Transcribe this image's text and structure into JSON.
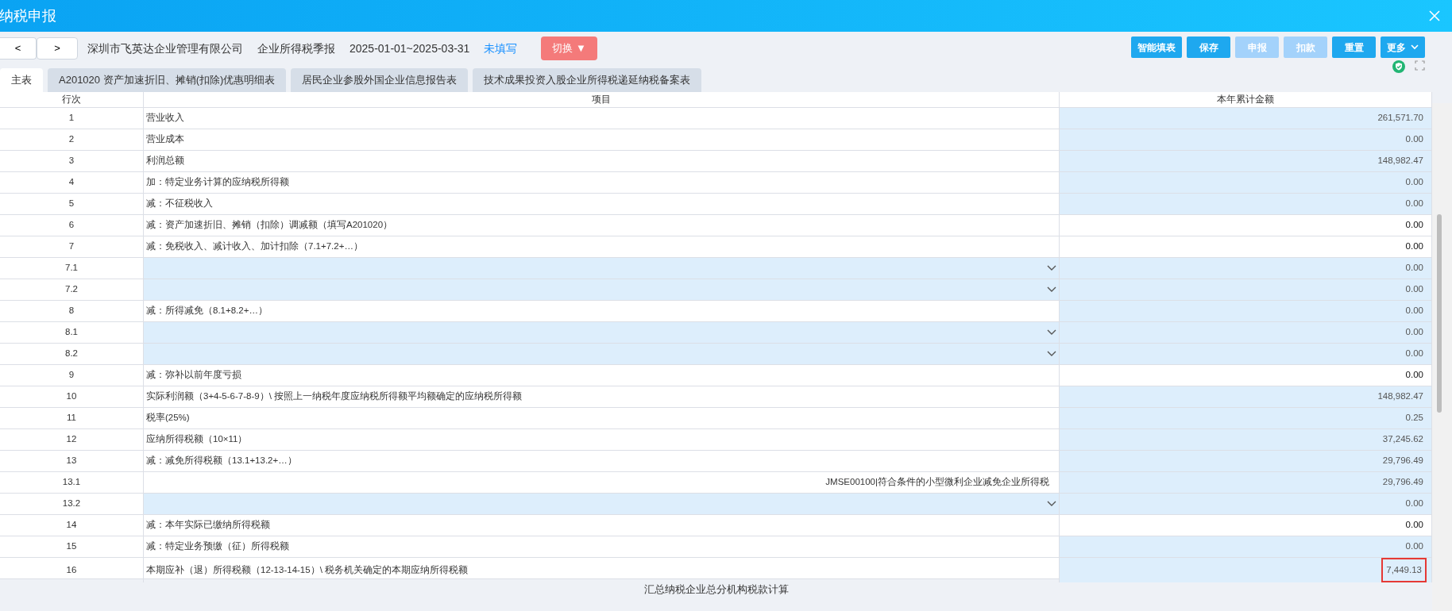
{
  "window": {
    "title": "纳税申报"
  },
  "toolbar": {
    "nav": [
      "<",
      ">"
    ],
    "company": "深圳市飞英达企业管理有限公司",
    "report": "企业所得税季报",
    "period": "2025-01-01~2025-03-31",
    "status": "未填写",
    "switch_button": "切换 ▼",
    "buttons": [
      {
        "label": "智能填表",
        "disabled": false,
        "dropdown": false
      },
      {
        "label": "保存",
        "disabled": false,
        "dropdown": false
      },
      {
        "label": "申报",
        "disabled": true,
        "dropdown": false
      },
      {
        "label": "扣款",
        "disabled": true,
        "dropdown": false
      },
      {
        "label": "重置",
        "disabled": false,
        "dropdown": false
      },
      {
        "label": "更多",
        "disabled": false,
        "dropdown": true
      }
    ]
  },
  "tabs": [
    {
      "label": "主表",
      "selected": true
    },
    {
      "label": "A201020 资产加速折旧、摊销(扣除)优惠明细表",
      "selected": false
    },
    {
      "label": "居民企业参股外国企业信息报告表",
      "selected": false
    },
    {
      "label": "技术成果投资入股企业所得税递延纳税备案表",
      "selected": false
    }
  ],
  "table": {
    "columns": [
      "行次",
      "项目",
      "本年累计金额"
    ],
    "rows": [
      {
        "no": "1",
        "kind": "text",
        "item": "营业收入",
        "value": "261,571.70",
        "editable": false,
        "highlighted": false
      },
      {
        "no": "2",
        "kind": "text",
        "item": "营业成本",
        "value": "0.00",
        "editable": false,
        "highlighted": false
      },
      {
        "no": "3",
        "kind": "text",
        "item": "利润总额",
        "value": "148,982.47",
        "editable": false,
        "highlighted": false
      },
      {
        "no": "4",
        "kind": "text",
        "item": "加：特定业务计算的应纳税所得额",
        "value": "0.00",
        "editable": false,
        "highlighted": false
      },
      {
        "no": "5",
        "kind": "text",
        "item": "减：不征税收入",
        "value": "0.00",
        "editable": false,
        "highlighted": false
      },
      {
        "no": "6",
        "kind": "text",
        "item": "减：资产加速折旧、摊销（扣除）调减额（填写A201020）",
        "value": "0.00",
        "editable": true,
        "highlighted": false
      },
      {
        "no": "7",
        "kind": "text",
        "item": "减：免税收入、减计收入、加计扣除（7.1+7.2+…）",
        "value": "0.00",
        "editable": true,
        "highlighted": false
      },
      {
        "no": "7.1",
        "kind": "select",
        "value": "0.00",
        "editable": false,
        "highlighted": false
      },
      {
        "no": "7.2",
        "kind": "select",
        "value": "0.00",
        "editable": false,
        "highlighted": false
      },
      {
        "no": "8",
        "kind": "text",
        "item": "减：所得减免（8.1+8.2+…）",
        "value": "0.00",
        "editable": false,
        "highlighted": false
      },
      {
        "no": "8.1",
        "kind": "select",
        "value": "0.00",
        "editable": false,
        "highlighted": false
      },
      {
        "no": "8.2",
        "kind": "select",
        "value": "0.00",
        "editable": false,
        "highlighted": false
      },
      {
        "no": "9",
        "kind": "text",
        "item": "减：弥补以前年度亏损",
        "value": "0.00",
        "editable": true,
        "highlighted": false
      },
      {
        "no": "10",
        "kind": "text",
        "item": "实际利润额（3+4-5-6-7-8-9）\\ 按照上一纳税年度应纳税所得额平均额确定的应纳税所得额",
        "value": "148,982.47",
        "editable": false,
        "highlighted": false
      },
      {
        "no": "11",
        "kind": "text",
        "item": "税率(25%)",
        "value": "0.25",
        "editable": false,
        "highlighted": false
      },
      {
        "no": "12",
        "kind": "text",
        "item": "应纳所得税额（10×11）",
        "value": "37,245.62",
        "editable": false,
        "highlighted": false
      },
      {
        "no": "13",
        "kind": "text",
        "item": "减：减免所得税额（13.1+13.2+…）",
        "value": "29,796.49",
        "editable": false,
        "highlighted": false
      },
      {
        "no": "13.1",
        "kind": "code",
        "item": "JMSE00100|符合条件的小型微利企业减免企业所得税",
        "value": "29,796.49",
        "editable": false,
        "highlighted": false
      },
      {
        "no": "13.2",
        "kind": "select",
        "value": "0.00",
        "editable": false,
        "highlighted": false
      },
      {
        "no": "14",
        "kind": "text",
        "item": "减：本年实际已缴纳所得税额",
        "value": "0.00",
        "editable": true,
        "highlighted": false
      },
      {
        "no": "15",
        "kind": "text",
        "item": "减：特定业务预缴（征）所得税额",
        "value": "0.00",
        "editable": false,
        "highlighted": false
      },
      {
        "no": "16",
        "kind": "text",
        "item": "本期应补（退）所得税额（12-13-14-15）\\ 税务机关确定的本期应纳所得税额",
        "value": "7,449.13",
        "editable": false,
        "highlighted": true
      }
    ]
  },
  "section_title": "汇总纳税企业总分机构税款计算"
}
